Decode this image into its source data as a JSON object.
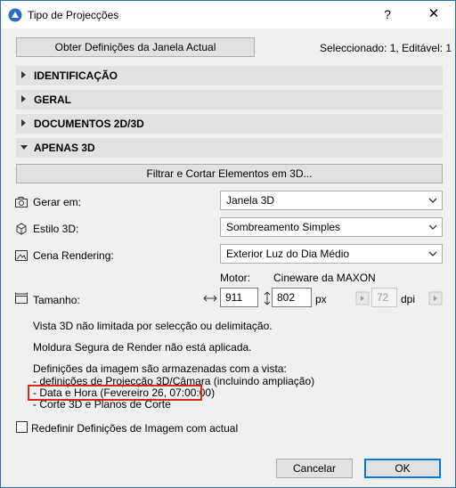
{
  "window": {
    "title": "Tipo de Projecções",
    "help_glyph": "?",
    "close_glyph": "✕"
  },
  "top": {
    "get_button": "Obter Definições da Janela Actual",
    "status": "Seleccionado: 1, Editável: 1"
  },
  "sections": [
    {
      "label": "IDENTIFICAÇÃO",
      "expanded": false
    },
    {
      "label": "GERAL",
      "expanded": false
    },
    {
      "label": "DOCUMENTOS 2D/3D",
      "expanded": false
    },
    {
      "label": "APENAS 3D",
      "expanded": true
    }
  ],
  "apenas3d": {
    "filter_button": "Filtrar e Cortar Elementos em 3D...",
    "gerar_em": {
      "label": "Gerar em:",
      "value": "Janela 3D"
    },
    "estilo": {
      "label": "Estilo 3D:",
      "value": "Sombreamento Simples"
    },
    "cena": {
      "label": "Cena Rendering:",
      "value": "Exterior Luz do Dia Médio"
    },
    "motor": {
      "label": "Motor:",
      "value": "Cineware da MAXON"
    },
    "tamanho": {
      "label": "Tamanho:",
      "width": "911",
      "height": "802",
      "unit": "px",
      "dpi_value": "72",
      "dpi_unit": "dpi"
    },
    "info": {
      "line1": "Vista 3D não limitada por selecção ou delimitação.",
      "line2": "Moldura Segura de Render não está aplicada.",
      "line3": "Definições da imagem são armazenadas com a vista:",
      "line4": "- definições de Projecção 3D/Câmara (incluindo ampliação)",
      "line5": "- Data e Hora (Fevereiro 26, 07:00:00)",
      "line6": "- Corte 3D e Planos de Corte"
    }
  },
  "redefine_checkbox": {
    "label": "Redefinir Definições de Imagem com actual",
    "checked": false
  },
  "footer": {
    "cancel": "Cancelar",
    "ok": "OK"
  },
  "colors": {
    "accent": "#0078d7",
    "highlight": "#e0261a",
    "section_bg": "#e2e2e2"
  }
}
